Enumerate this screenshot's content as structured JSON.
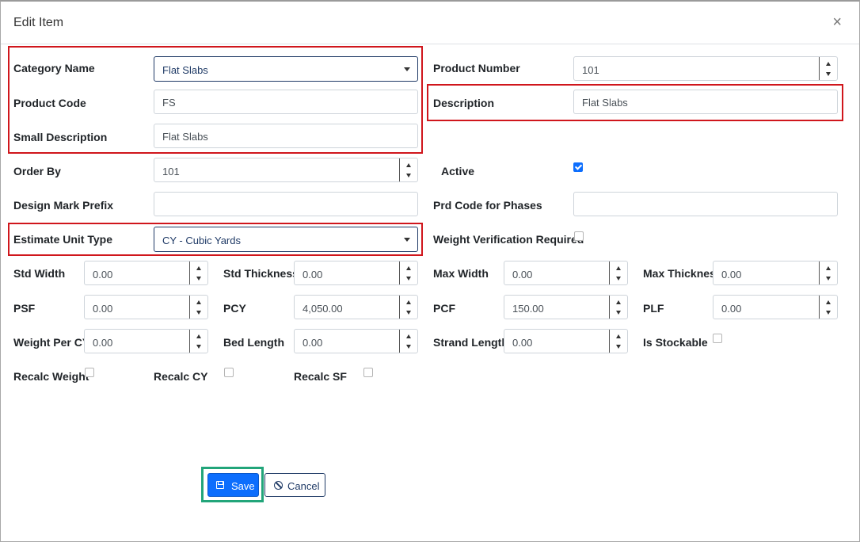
{
  "modal": {
    "title": "Edit Item",
    "close_symbol": "×"
  },
  "fields": {
    "category_name": {
      "label": "Category Name",
      "value": "Flat Slabs"
    },
    "product_number": {
      "label": "Product Number",
      "value": "101"
    },
    "product_code": {
      "label": "Product Code",
      "value": "FS"
    },
    "description": {
      "label": "Description",
      "value": "Flat Slabs"
    },
    "small_description": {
      "label": "Small Description",
      "value": "Flat Slabs"
    },
    "order_by": {
      "label": "Order By",
      "value": "101"
    },
    "active": {
      "label": "Active",
      "checked": true
    },
    "design_mark_prefix": {
      "label": "Design Mark Prefix",
      "value": ""
    },
    "prd_code_for_phases": {
      "label": "Prd Code for Phases",
      "value": ""
    },
    "estimate_unit_type": {
      "label": "Estimate Unit Type",
      "value": "CY - Cubic Yards"
    },
    "weight_verification_required": {
      "label": "Weight Verification Required",
      "checked": false
    },
    "std_width": {
      "label": "Std Width",
      "value": "0.00"
    },
    "std_thickness": {
      "label": "Std Thickness",
      "value": "0.00"
    },
    "max_width": {
      "label": "Max Width",
      "value": "0.00"
    },
    "max_thickness": {
      "label": "Max Thickness",
      "value": "0.00"
    },
    "psf": {
      "label": "PSF",
      "value": "0.00"
    },
    "pcy": {
      "label": "PCY",
      "value": "4,050.00"
    },
    "pcf": {
      "label": "PCF",
      "value": "150.00"
    },
    "plf": {
      "label": "PLF",
      "value": "0.00"
    },
    "weight_per_cy": {
      "label": "Weight Per CY",
      "value": "0.00"
    },
    "bed_length": {
      "label": "Bed Length",
      "value": "0.00"
    },
    "strand_length": {
      "label": "Strand Length",
      "value": "0.00"
    },
    "is_stockable": {
      "label": "Is Stockable",
      "checked": false
    },
    "recalc_weight": {
      "label": "Recalc Weight",
      "checked": false
    },
    "recalc_cy": {
      "label": "Recalc CY",
      "checked": false
    },
    "recalc_sf": {
      "label": "Recalc SF",
      "checked": false
    }
  },
  "buttons": {
    "save_label": "Save",
    "cancel_label": "Cancel"
  },
  "colors": {
    "highlight_red": "#d0161c",
    "highlight_green": "#22a57a",
    "primary": "#0d6efd"
  }
}
